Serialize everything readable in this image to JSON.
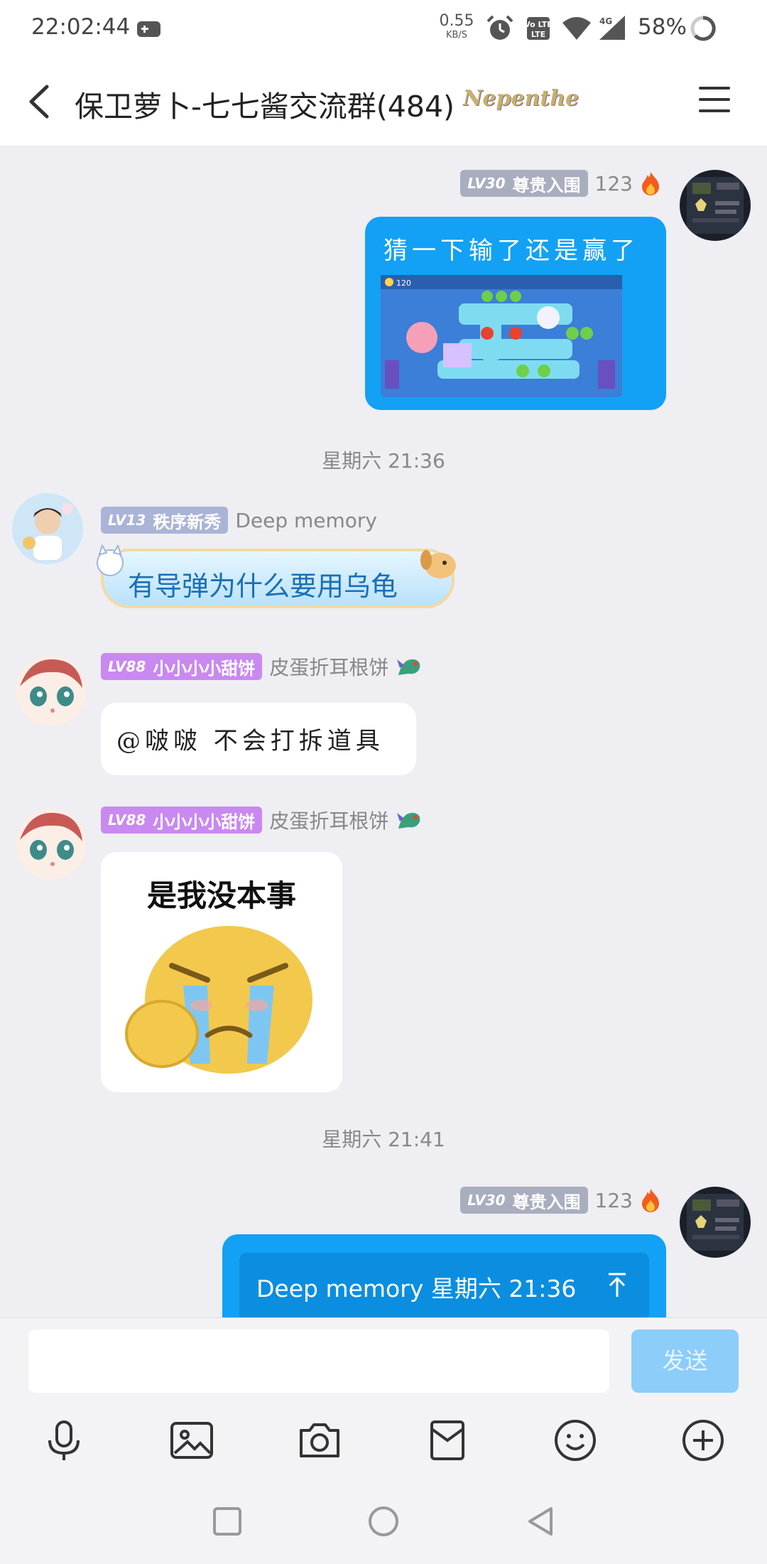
{
  "status": {
    "time": "22:02:44",
    "net_speed_value": "0.55",
    "net_speed_unit": "KB/S",
    "network_label": "4G",
    "volte_label": "Vo LTE",
    "battery": "58%"
  },
  "header": {
    "title": "保卫萝卜-七七酱交流群(484)",
    "title_badge": "Nepenthe"
  },
  "messages": {
    "m1": {
      "level_num": "LV30",
      "level_title": "尊贵入围",
      "sender": "123",
      "text": "猜一下输了还是赢了",
      "game_score": "120"
    },
    "sep1": "星期六 21:36",
    "m2": {
      "level_num": "LV13",
      "level_title": "秩序新秀",
      "sender": "Deep memory",
      "text": "有导弹为什么要用乌龟"
    },
    "m3": {
      "level_num": "LV88",
      "level_title": "小小小小甜饼",
      "sender": "皮蛋折耳根饼",
      "text": "@啵啵 不会打拆道具"
    },
    "m4": {
      "level_num": "LV88",
      "level_title": "小小小小甜饼",
      "sender": "皮蛋折耳根饼",
      "sticker_caption": "是我没本事"
    },
    "sep2": "星期六 21:41",
    "m5": {
      "level_num": "LV30",
      "level_title": "尊贵入围",
      "sender": "123",
      "reply_quote": "Deep memory 星期六 21:36"
    }
  },
  "input": {
    "placeholder": "",
    "send_label": "发送"
  },
  "icons": {
    "accent": "#12a1f5",
    "send_disabled": "#8ccdf9"
  }
}
